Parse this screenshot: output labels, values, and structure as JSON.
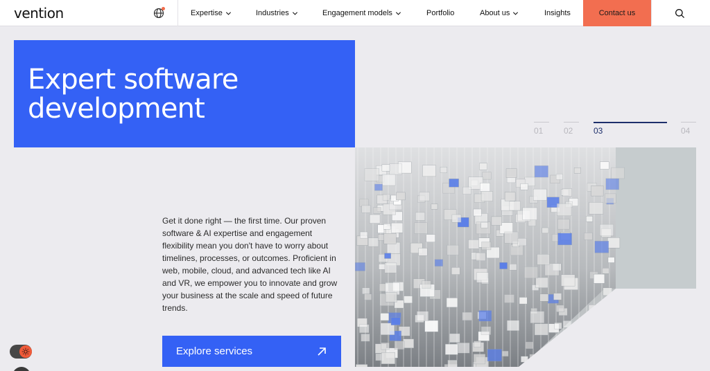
{
  "header": {
    "logo": "vention",
    "nav": [
      {
        "label": "Expertise",
        "has_dropdown": true
      },
      {
        "label": "Industries",
        "has_dropdown": true
      },
      {
        "label": "Engagement models",
        "has_dropdown": true
      },
      {
        "label": "Portfolio",
        "has_dropdown": false
      },
      {
        "label": "About us",
        "has_dropdown": true
      },
      {
        "label": "Insights",
        "has_dropdown": false
      }
    ],
    "contact_label": "Contact us",
    "icons": {
      "language": "globe-icon",
      "search": "search-icon"
    }
  },
  "hero": {
    "title_line1": "Expert software",
    "title_line2": "development",
    "description": "Get it done right — the first time. Our proven software & AI expertise and engagement flexibility mean you don't have to worry about timelines, processes, or outcomes. Proficient in web, mobile, cloud, and advanced tech like AI and VR, we empower you to innovate and grow your business at the scale and speed of future trends.",
    "cta_label": "Explore services",
    "cta_icon": "arrow-up-right-icon"
  },
  "slider": {
    "items": [
      "01",
      "02",
      "03",
      "04"
    ],
    "active_index": 2
  },
  "colors": {
    "brand_blue": "#3461f5",
    "contact_orange": "#f26e50",
    "active_indicator": "#1d2f6b"
  },
  "theme_toggle_icon": "sun-icon"
}
